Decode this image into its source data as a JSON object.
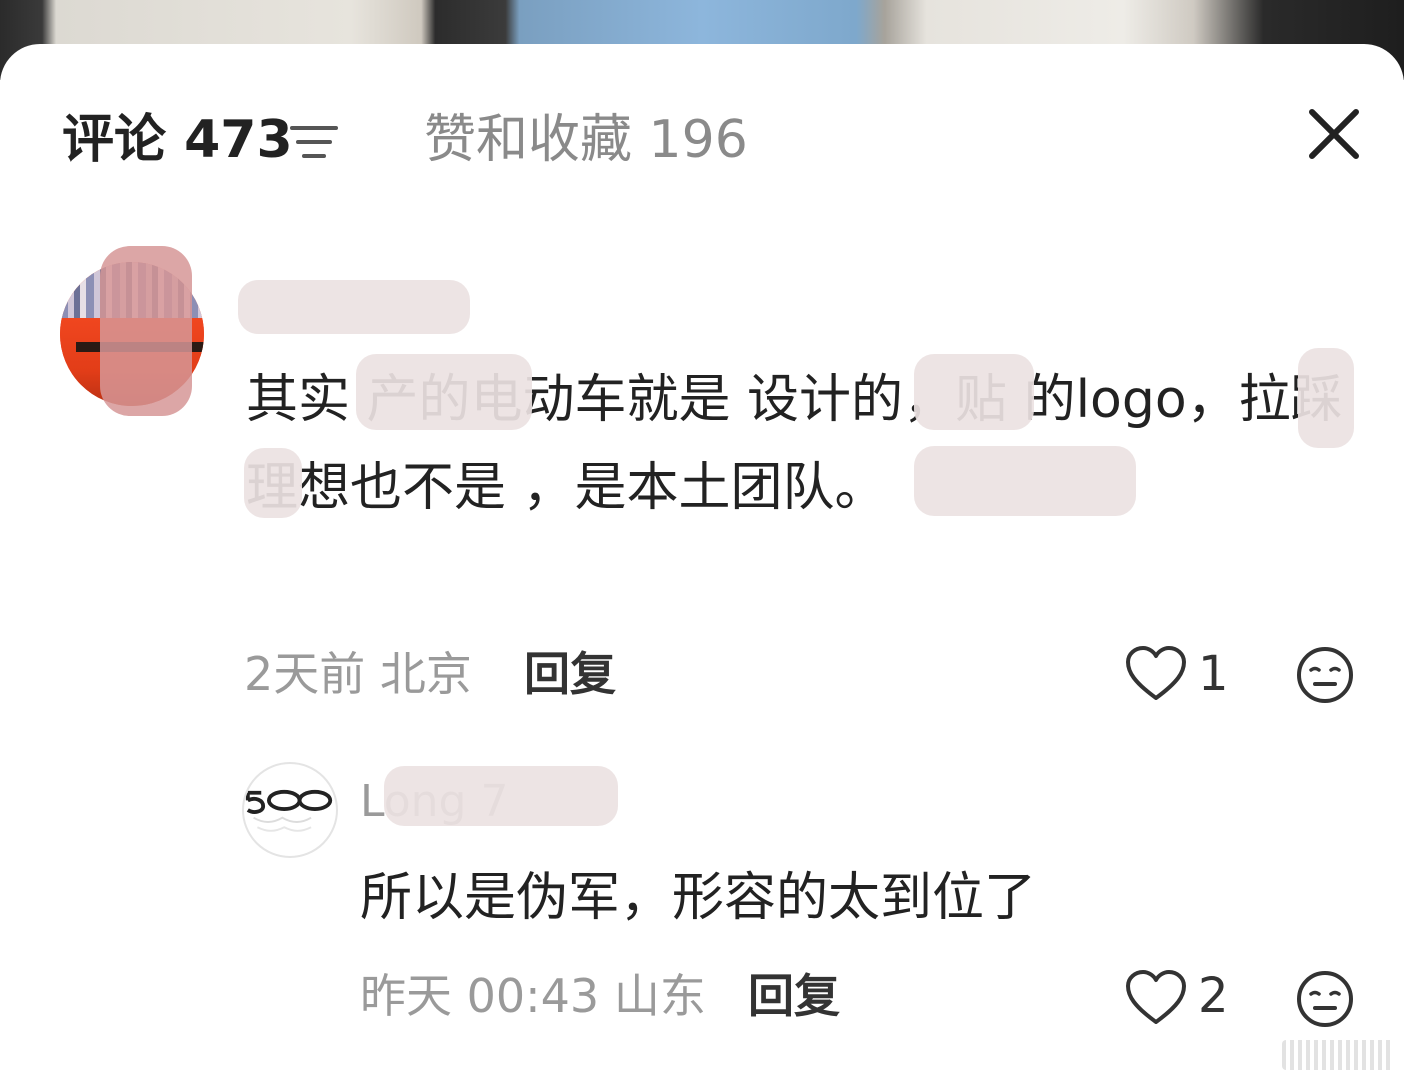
{
  "header": {
    "comments_tab": "评论 473",
    "likes_tab": "赞和收藏 196",
    "sort_icon": "sort-lines-icon",
    "close_icon": "close-icon"
  },
  "comments": [
    {
      "username": "",
      "text": "其实  产的电动车就是  设计的，贴  的logo，拉踩理想也不是  ，是本土团队。",
      "time": "2天前",
      "location": "北京",
      "reply_label": "回复",
      "likes": "1",
      "like_icon": "heart-outline-icon",
      "reaction_icon": "meh-face-icon"
    },
    {
      "username": "Long  7",
      "text": "所以是伪军，形容的太到位了",
      "time": "昨天 00:43",
      "location": "山东",
      "reply_label": "回复",
      "likes": "2",
      "like_icon": "heart-outline-icon",
      "reaction_icon": "meh-face-icon"
    }
  ],
  "colors": {
    "primary_text": "#222222",
    "secondary_text": "#9a9a9a",
    "background": "#ffffff"
  }
}
